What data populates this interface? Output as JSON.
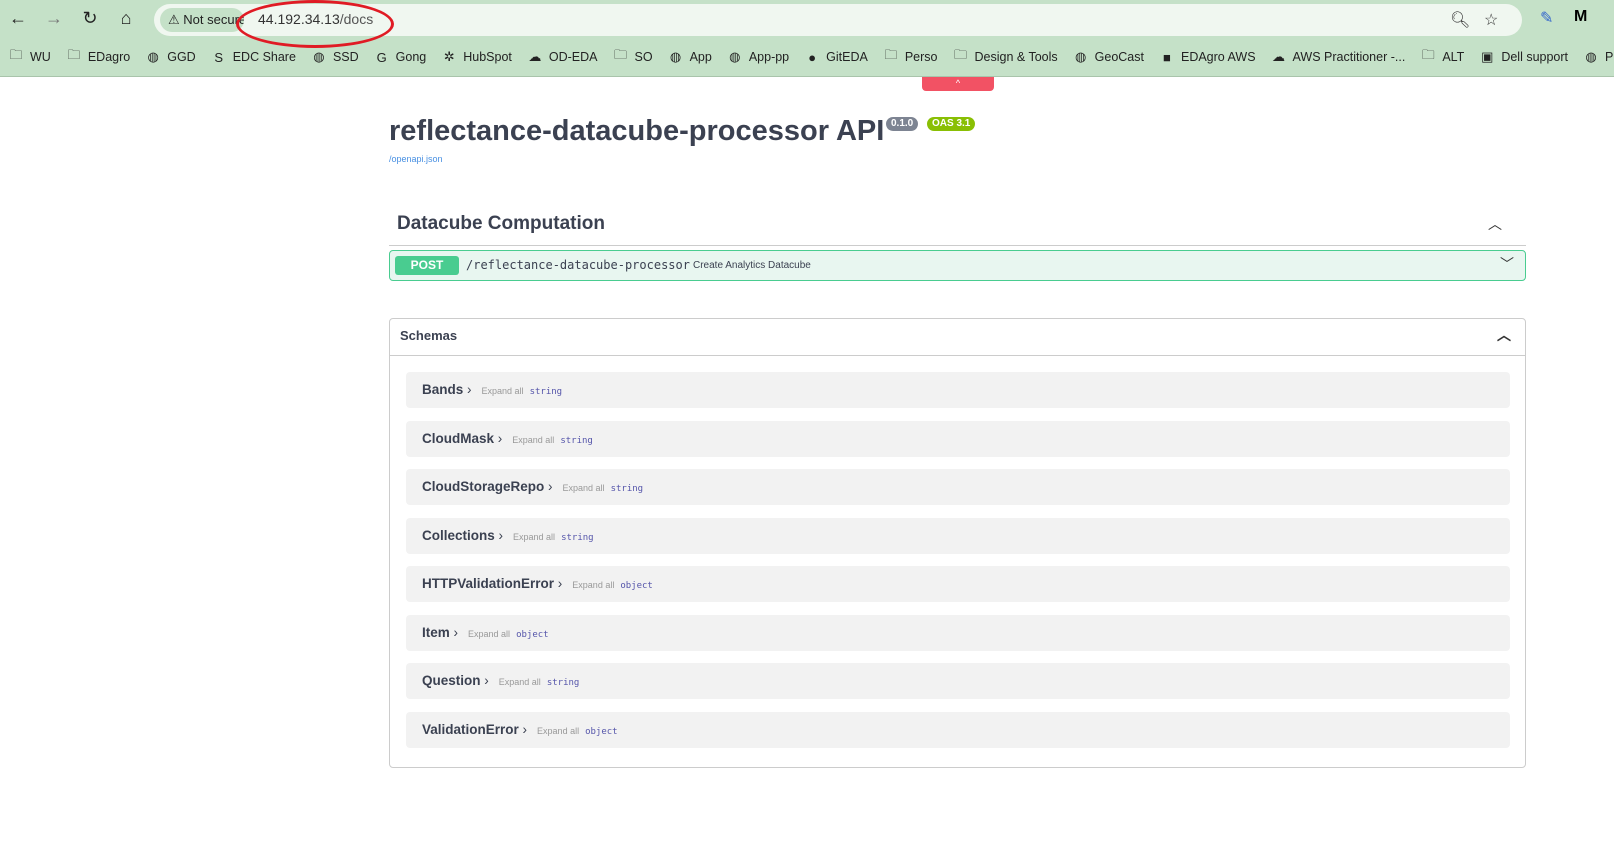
{
  "browser": {
    "security": "Not secure",
    "url_host": "44.192.34.13",
    "url_path": "/docs",
    "bookmarks": [
      {
        "label": "WU",
        "icon": "folder-icon"
      },
      {
        "label": "EDagro",
        "icon": "folder-icon"
      },
      {
        "label": "GGD",
        "icon": "globe-icon"
      },
      {
        "label": "EDC Share",
        "icon": "sharepoint-icon"
      },
      {
        "label": "SSD",
        "icon": "globe-icon"
      },
      {
        "label": "Gong",
        "icon": "gong-icon"
      },
      {
        "label": "HubSpot",
        "icon": "hubspot-icon"
      },
      {
        "label": "OD-EDA",
        "icon": "onedrive-icon"
      },
      {
        "label": "SO",
        "icon": "folder-icon"
      },
      {
        "label": "App",
        "icon": "globe-icon"
      },
      {
        "label": "App-pp",
        "icon": "globe-icon"
      },
      {
        "label": "GitEDA",
        "icon": "github-icon"
      },
      {
        "label": "Perso",
        "icon": "folder-icon"
      },
      {
        "label": "Design & Tools",
        "icon": "folder-icon"
      },
      {
        "label": "GeoCast",
        "icon": "globe-icon"
      },
      {
        "label": "EDAgro AWS",
        "icon": "aws-icon"
      },
      {
        "label": "AWS Practitioner -...",
        "icon": "onedrive-icon"
      },
      {
        "label": "ALT",
        "icon": "folder-icon"
      },
      {
        "label": "Dell support",
        "icon": "dell-icon"
      },
      {
        "label": "PMC",
        "icon": "globe-icon"
      }
    ]
  },
  "api": {
    "title": "reflectance-datacube-processor API",
    "version": "0.1.0",
    "oas": "OAS 3.1",
    "spec_link": "/openapi.json"
  },
  "section": {
    "title": "Datacube Computation",
    "operation": {
      "method": "POST",
      "path": "/reflectance-datacube-processor",
      "summary": "Create Analytics Datacube"
    }
  },
  "schemas": {
    "title": "Schemas",
    "expand_label": "Expand all",
    "items": [
      {
        "name": "Bands",
        "type": "string"
      },
      {
        "name": "CloudMask",
        "type": "string"
      },
      {
        "name": "CloudStorageRepo",
        "type": "string"
      },
      {
        "name": "Collections",
        "type": "string"
      },
      {
        "name": "HTTPValidationError",
        "type": "object"
      },
      {
        "name": "Item",
        "type": "object"
      },
      {
        "name": "Question",
        "type": "string"
      },
      {
        "name": "ValidationError",
        "type": "object"
      }
    ]
  },
  "colors": {
    "post": "#49cc90",
    "badge_version": "#89bf04",
    "annotation": "#e01b24"
  }
}
